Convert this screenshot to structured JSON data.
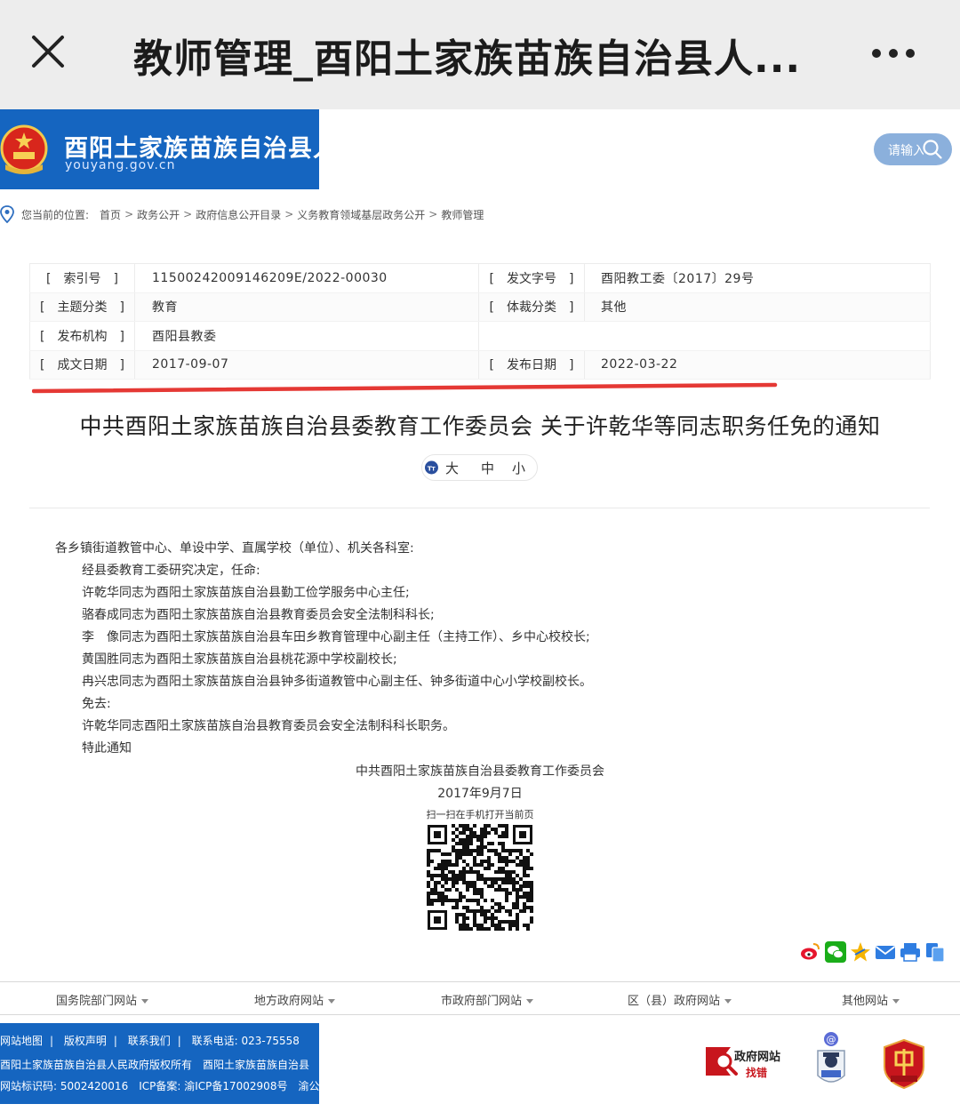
{
  "appbar": {
    "title": "教师管理_酉阳土家族苗族自治县人...",
    "close_icon": "close-icon",
    "more_icon": "more-icon"
  },
  "header": {
    "site_name": "酉阳土家族苗族自治县人",
    "domain": "youyang.gov.cn",
    "search_placeholder": "请输入"
  },
  "breadcrumb": {
    "label": "您当前的位置:",
    "items": [
      "首页",
      "政务公开",
      "政府信息公开目录",
      "义务教育领域基层政务公开",
      "教师管理"
    ],
    "separator": ">"
  },
  "meta": {
    "index_key": "[　索引号　]",
    "index_val": "11500242009146209E/2022-00030",
    "docno_key": "[　发文字号　]",
    "docno_val": "酉阳教工委〔2017〕29号",
    "topic_key": "[　主题分类　]",
    "topic_val": "教育",
    "genre_key": "[　体裁分类　]",
    "genre_val": "其他",
    "issuer_key": "[　发布机构　]",
    "issuer_val": "酉阳县教委",
    "date_key": "[　成文日期　]",
    "date_val": "2017-09-07",
    "pub_key": "[　发布日期　]",
    "pub_val": "2022-03-22"
  },
  "article": {
    "title": "中共酉阳土家族苗族自治县委教育工作委员会 关于许乾华等同志职务任免的通知",
    "font_big": "大",
    "font_mid": "中",
    "font_small": "小",
    "lines": [
      "各乡镇街道教管中心、单设中学、直属学校（单位）、机关各科室:",
      "经县委教育工委研究决定，任命:",
      "许乾华同志为酉阳土家族苗族自治县勤工俭学服务中心主任;",
      "骆春成同志为酉阳土家族苗族自治县教育委员会安全法制科科长;",
      "李　像同志为酉阳土家族苗族自治县车田乡教育管理中心副主任（主持工作）、乡中心校校长;",
      "黄国胜同志为酉阳土家族苗族自治县桃花源中学校副校长;",
      "冉兴忠同志为酉阳土家族苗族自治县钟多街道教管中心副主任、钟多街道中心小学校副校长。",
      "免去:",
      "许乾华同志酉阳土家族苗族自治县教育委员会安全法制科科长职务。",
      "特此通知"
    ],
    "sign_org": "中共酉阳土家族苗族自治县委教育工作委员会",
    "sign_date": "2017年9月7日",
    "scan_hint": "扫一扫在手机打开当前页"
  },
  "share_icons": [
    "weibo-icon",
    "wechat-icon",
    "qzone-icon",
    "email-icon",
    "print-icon",
    "copy-icon"
  ],
  "footer_nav": [
    "国务院部门网站",
    "地方政府网站",
    "市政府部门网站",
    "区（县）政府网站",
    "其他网站"
  ],
  "footer": {
    "sitemap": "网站地图",
    "copyright": "版权声明",
    "contact": "联系我们",
    "phone": "联系电话: 023-75558",
    "owner": "酉阳土家族苗族自治县人民政府版权所有　酉阳土家族苗族自治县",
    "site_id": "网站标识码: 5002420016　ICP备案: 渝ICP备17002908号　渝公",
    "gov_badge_1": "政府网站",
    "gov_badge_2": "找错"
  },
  "colors": {
    "brand_blue": "#1565c0",
    "underline_red": "#e53935",
    "search_bg": "#8bb0dc"
  }
}
